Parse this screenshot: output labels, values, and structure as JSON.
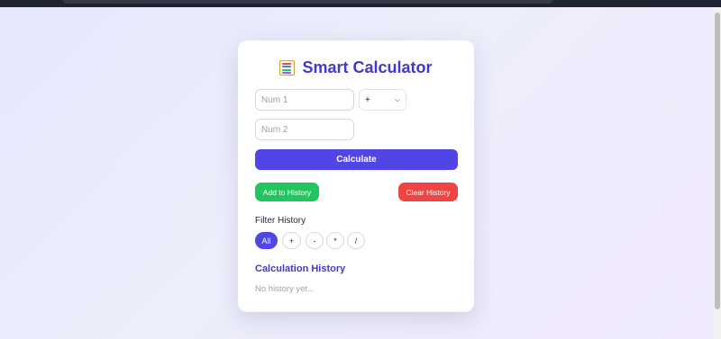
{
  "app": {
    "title": "Smart Calculator",
    "title_icon": "abacus-icon"
  },
  "inputs": {
    "num1": {
      "value": "",
      "placeholder": "Num 1"
    },
    "num2": {
      "value": "",
      "placeholder": "Num 2"
    },
    "operator": {
      "selected": "+"
    }
  },
  "buttons": {
    "calculate": "Calculate",
    "add_history": "Add to History",
    "clear_history": "Clear History"
  },
  "filter": {
    "label": "Filter History",
    "options": [
      "All",
      "+",
      "-",
      "*",
      "/"
    ],
    "active": "All"
  },
  "history": {
    "title": "Calculation History",
    "empty_text": "No history yet..."
  },
  "colors": {
    "primary": "#4f46e5",
    "title": "#4338ca",
    "success": "#22c55e",
    "danger": "#ef4444"
  }
}
